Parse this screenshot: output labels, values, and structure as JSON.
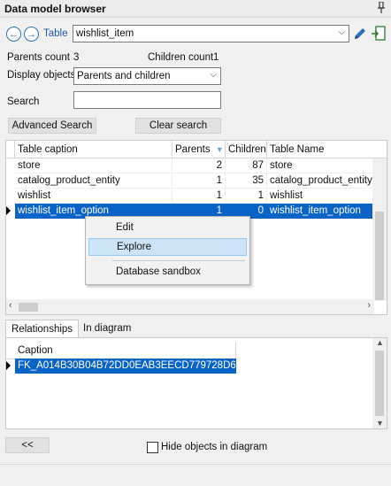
{
  "panel": {
    "title": "Data model browser",
    "pin_icon": "pin-icon"
  },
  "toolbar": {
    "table_label": "Table",
    "table_value": "wishlist_item",
    "back_icon": "back-arrow-icon",
    "forward_icon": "forward-arrow-icon",
    "edit_icon": "pencil-icon",
    "export_icon": "export-icon"
  },
  "counts": {
    "parents_label": "Parents count",
    "parents_value": "3",
    "children_label": "Children count",
    "children_value": "1"
  },
  "display": {
    "label": "Display objects",
    "value": "Parents and children"
  },
  "search": {
    "label": "Search",
    "value": ""
  },
  "buttons": {
    "advanced_search": "Advanced Search",
    "clear_search": "Clear search",
    "collapse": "<<"
  },
  "grid": {
    "headers": [
      "Table caption",
      "Parents",
      "Children",
      "Table Name"
    ],
    "rows": [
      [
        "store",
        "2",
        "87",
        "store"
      ],
      [
        "catalog_product_entity",
        "1",
        "35",
        "catalog_product_entity"
      ],
      [
        "wishlist",
        "1",
        "1",
        "wishlist"
      ],
      [
        "wishlist_item_option",
        "1",
        "0",
        "wishlist_item_option"
      ]
    ]
  },
  "context_menu": {
    "items": [
      "Edit",
      "Explore",
      "Database sandbox"
    ]
  },
  "tabs": [
    "Relationships",
    "In diagram"
  ],
  "relationships": {
    "header": "Caption",
    "rows": [
      "FK_A014B30B04B72DD0EAB3EECD779728D6"
    ]
  },
  "footer": {
    "hide_label": "Hide objects in diagram"
  },
  "colors": {
    "selection": "#0a64c8",
    "menu_highlight": "#cce4f7",
    "accent": "#2e6fb6"
  }
}
